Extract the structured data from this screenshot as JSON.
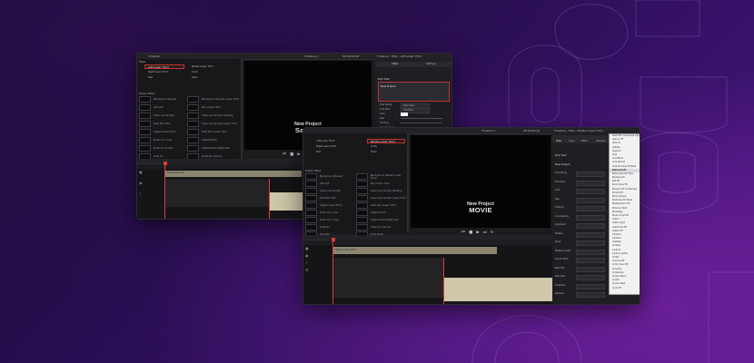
{
  "window1": {
    "toolbar_title": "Timeline",
    "timeline_name": "Timeline 1",
    "timecode": "00:00:00:00",
    "inspector_title": "Timeline - Title - Left Lower Third",
    "inspector_tabs": [
      "Video",
      "Settings"
    ],
    "rich_text_label": "Rich Text",
    "text_value": "New Project",
    "inspector_rows": [
      "Font Family",
      "Font Face",
      "Color",
      "Size",
      "Tracking",
      "Line Spacing"
    ],
    "font_family_value": "Open Sans",
    "font_face_value": "Semibold",
    "titles_header": "Titles",
    "titles_top": [
      "Left Lower Third",
      "Middle Lower Third",
      "Right Lower Third",
      "Scroll",
      "Text",
      "Text+"
    ],
    "fusion_titles_header": "Fusion Titles",
    "fusion_titles_left": [
      "Background Reveal",
      "Call Out",
      "Clean and Simple",
      "Dark Box Text",
      "Digital Lower Third",
      "Draw On 1 Line",
      "Draw On 2 Lines",
      "Fade On"
    ],
    "fusion_titles_right": [
      "Background Reveal Lower Third",
      "Box Lower Third",
      "Clean and Simple Heading",
      "Clean and Simple Lower Third",
      "Dark Box Lower Third",
      "Digital Glitch",
      "Digital Glitch Right Side",
      "Draw On Corners"
    ],
    "viewer_title_line1": "New Project",
    "viewer_title_line2": "Sample",
    "timeline_track_label": "Left Lower Third",
    "timeline_track_label2": "Cinematic 1"
  },
  "window2": {
    "timeline_name": "Timeline 1",
    "timecode": "00:00:04:14",
    "inspector_title": "Timeline - Title - Middle Lower Third",
    "inspector_tabs": [
      "Video",
      "Audio",
      "Effect",
      "Transition",
      "Image",
      "File"
    ],
    "rich_text_label": "Rich Text",
    "text_value": "New Project",
    "inspector_rows": [
      "Font Family",
      "Font Face",
      "Color",
      "Size",
      "Tracking",
      "Line Spacing",
      "Alignment",
      "Position",
      "Zoom",
      "Rotation Angle",
      "Anchor Point",
      "Bold Text",
      "Italic Text",
      "Underline",
      "Strikeout"
    ],
    "font_dropdown_items": [
      "Abadi MT Condensed Light",
      "Agency FB",
      "Aharoni",
      "Aldhabi",
      "Algerian",
      "Arial",
      "Arial Black",
      "Arial Narrow",
      "Arial Rounded MT Bold",
      "Bahnschrift",
      "Baskerville Old Face",
      "Bauhaus 93",
      "Bell MT",
      "Berlin Sans FB",
      "Bernard MT Condensed",
      "Bodoni MT",
      "Book Antiqua",
      "Bookman Old Style",
      "Bradley Hand ITC",
      "Britannic Bold",
      "Broadway",
      "Brush Script MT",
      "Calibri",
      "Calibri Light",
      "Californian FB",
      "Calisto MT",
      "Cambria",
      "Candara",
      "Castellar",
      "Centaur",
      "Century",
      "Century Gothic",
      "Chiller",
      "Colonna MT",
      "Comic Sans MS",
      "Consolas",
      "Constantia",
      "Cooper Black",
      "Corbel",
      "Courier New",
      "Curlz MT"
    ],
    "font_dropdown_selected_index": 9,
    "titles_top": [
      "Left Lower Third",
      "Middle Lower Third",
      "Right Lower Third",
      "Scroll",
      "Text",
      "Text+"
    ],
    "fusion_titles_header": "Fusion Titles",
    "fusion_titles_left": [
      "Background Reveal",
      "Call Out",
      "Clean and Simple",
      "Dark Box Text",
      "Digital Lower Third",
      "Draw On 1 Line",
      "Draw On 2 Lines",
      "Fade On",
      "Film Noir"
    ],
    "fusion_titles_right": [
      "Background Reveal Lower Third",
      "Box Lower Third",
      "Clean and Simple Heading",
      "Clean and Simple Lower Third",
      "Dark Box Lower Third",
      "Digital Glitch",
      "Digital Glitch Right Side",
      "Draw On Corners",
      "Drop Down"
    ],
    "viewer_title_line1": "New Project",
    "viewer_title_line2": "MOVIE",
    "timeline_track_label": "Middle Lower Third"
  },
  "colors": {
    "bg_dark": "#1a0b35",
    "bg_purple": "#5a1a8a",
    "window_bg": "#1c1c1f",
    "selection_red": "#c0342c",
    "playhead_red": "#e3393a",
    "clip_beige": "#cfc7a9"
  },
  "icons": [
    "play-icon",
    "stop-icon",
    "skip-back-icon",
    "skip-forward-icon",
    "loop-icon",
    "gear-icon",
    "keyframe-icon",
    "speaker-icon",
    "lock-icon",
    "eye-icon"
  ]
}
